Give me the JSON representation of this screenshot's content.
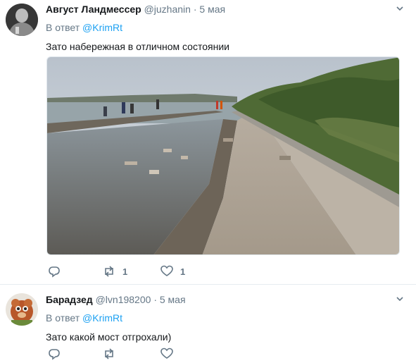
{
  "tweets": [
    {
      "name": "Август Ландмессер",
      "handle": "@juzhanin",
      "dot": "·",
      "time": "5 мая",
      "reply_prefix": "В ответ",
      "reply_mention": "@KrimRt",
      "text": "Зато набережная в отличном состоянии",
      "retweets": "1",
      "likes": "1"
    },
    {
      "name": "Барадзед",
      "handle": "@lvn198200",
      "dot": "·",
      "time": "5 мая",
      "reply_prefix": "В ответ",
      "reply_mention": "@KrimRt",
      "text": "Зато какой мост отгрохали)",
      "retweets": "",
      "likes": ""
    }
  ],
  "icons": {
    "more": "chevron-down-icon",
    "reply": "reply-icon",
    "retweet": "retweet-icon",
    "like": "heart-icon"
  },
  "colors": {
    "link": "#1da1f2",
    "muted": "#657786",
    "text": "#14171a",
    "border": "#e6ecf0"
  }
}
